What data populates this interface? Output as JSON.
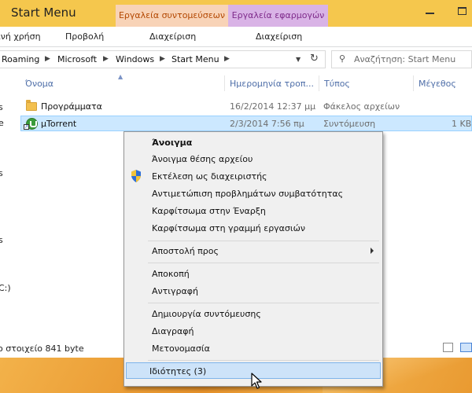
{
  "window": {
    "title": "Start Menu",
    "context_tabs": [
      "Εργαλεία συντομεύσεων",
      "Εργαλεία εφαρμογών"
    ]
  },
  "ribbon": {
    "share": "ινή χρήση",
    "view": "Προβολή",
    "manage1": "Διαχείριση",
    "manage2": "Διαχείριση"
  },
  "address": {
    "crumbs": [
      "Roaming",
      "Microsoft",
      "Windows",
      "Start Menu"
    ],
    "search_placeholder": "Αναζήτηση: Start Menu"
  },
  "columns": {
    "name": "Όνομα",
    "date": "Ημερομηνία τροπ...",
    "type": "Τύπος",
    "size": "Μέγεθος"
  },
  "files": [
    {
      "name": "Προγράμματα",
      "date": "16/2/2014 12:37 μμ",
      "type": "Φάκελος αρχείων",
      "size": ""
    },
    {
      "name": "µTorrent",
      "date": "2/3/2014 7:56 πμ",
      "type": "Συντόμευση",
      "size": "1 KB"
    }
  ],
  "nav_fragments": [
    "s",
    "e",
    "s",
    "s",
    "C:)"
  ],
  "status": {
    "text": "ο στοιχείο  841 byte"
  },
  "context_menu": {
    "open": "Άνοιγμα",
    "open_location": "Άνοιγμα θέσης αρχείου",
    "run_as_admin": "Εκτέλεση ως διαχειριστής",
    "troubleshoot": "Αντιμετώπιση προβλημάτων συμβατότητας",
    "pin_start": "Καρφίτσωμα στην Έναρξη",
    "pin_taskbar": "Καρφίτσωμα στη γραμμή εργασιών",
    "send_to": "Αποστολή προς",
    "cut": "Αποκοπή",
    "copy": "Αντιγραφή",
    "create_shortcut": "Δημιουργία συντόμευσης",
    "delete": "Διαγραφή",
    "rename": "Μετονομασία",
    "properties": "Ιδιότητες (3)"
  },
  "icons": [
    "folder-icon",
    "shortcut-icon",
    "shield-icon",
    "search-icon",
    "refresh-icon",
    "chevron-down-icon",
    "mouse-cursor-icon"
  ]
}
